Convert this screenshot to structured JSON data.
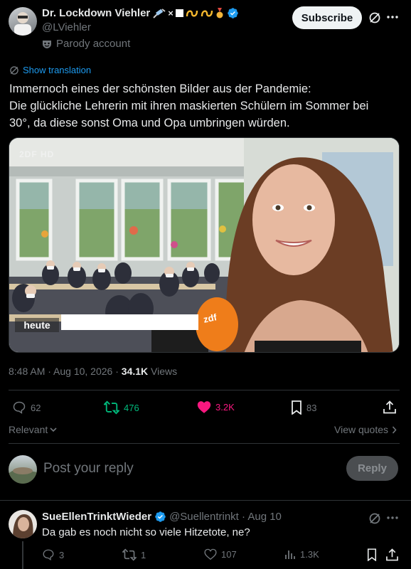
{
  "post": {
    "author_name": "Dr. Lockdown Viehler",
    "author_emojis": "💉×▪️➰➰🎖️",
    "handle": "@LViehler",
    "parody_label": "Parody account",
    "subscribe_label": "Subscribe",
    "show_translation": "Show translation",
    "text_line1": "Immernoch eines der schönsten Bilder aus der Pandemie:",
    "text_line2": "Die glückliche Lehrerin mit ihren maskierten Schülern im Sommer bei",
    "text_line3": "30°, da diese sonst Oma und Opa umbringen würden.",
    "media_watermark": "2DF HD",
    "media_caption": "heute",
    "mic_logo": "zdf",
    "timestamp": "8:48 AM · Aug 10, 2026 · ",
    "views_count": "34.1K",
    "views_label": " Views",
    "replies": "62",
    "reposts": "476",
    "likes": "3.2K",
    "bookmarks": "83",
    "sort_label": "Relevant",
    "view_quotes": "View quotes"
  },
  "composer": {
    "placeholder": "Post your reply",
    "reply_label": "Reply"
  },
  "reply": {
    "author_name": "SueEllenTrinktWieder",
    "handle_date": "@Suellentrinkt · Aug 10",
    "text": "Da gab es noch nicht so viele Hitzetote, ne?",
    "replies": "3",
    "reposts": "1",
    "likes": "107",
    "views": "1.3K"
  },
  "colors": {
    "background": "#000000",
    "text": "#e7e9ea",
    "muted": "#71767b",
    "link": "#1d9bf0",
    "repost": "#00ba7c",
    "like": "#f91880",
    "verified": "#1d9bf0"
  }
}
